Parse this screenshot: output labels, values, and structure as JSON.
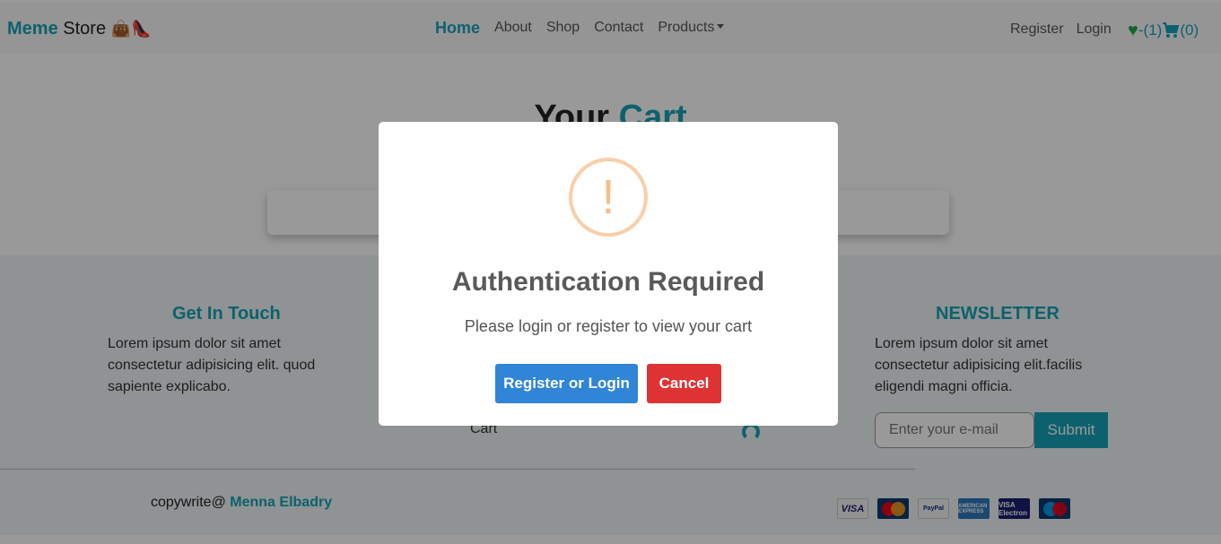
{
  "navbar": {
    "brand_part1": "Meme",
    "brand_part2": "Store",
    "brand_emoji": "👜👠",
    "links": [
      "Home",
      "About",
      "Shop",
      "Contact",
      "Products"
    ],
    "register": "Register",
    "login": "Login",
    "wishlist_count": "-(1)",
    "cart_count": "(0)"
  },
  "page": {
    "title_part1": "Your",
    "title_part2": "Cart"
  },
  "footer": {
    "get_in_touch_title": "Get In Touch",
    "get_in_touch_text": "Lorem ipsum dolor sit amet consectetur adipisicing elit. quod sapiente explicabo.",
    "cart_link": "Cart",
    "newsletter_title": "NEWSLETTER",
    "newsletter_text": "Lorem ipsum dolor sit amet consectetur adipisicing elit.facilis eligendi magni officia.",
    "email_placeholder": "Enter your e-mail",
    "submit_label": "Submit",
    "copyright_prefix": "copywrite@",
    "copyright_author": "Menna Elbadry",
    "payment_icons": [
      "visa",
      "mastercard",
      "paypal",
      "american-express",
      "visa-electron",
      "maestro"
    ],
    "payment_labels": {
      "visa": "VISA",
      "paypal": "PayPal",
      "amex": "AMERICAN EXPRESS",
      "electron": "VISA Electron"
    }
  },
  "modal": {
    "icon": "exclamation",
    "title": "Authentication Required",
    "text": "Please login or register to view your cart",
    "confirm_label": "Register or Login",
    "cancel_label": "Cancel"
  },
  "colors": {
    "accent": "#17a2b8",
    "confirm": "#3085d6",
    "cancel": "#dd3333",
    "warning": "#f8bb86",
    "heart": "#28a745"
  }
}
